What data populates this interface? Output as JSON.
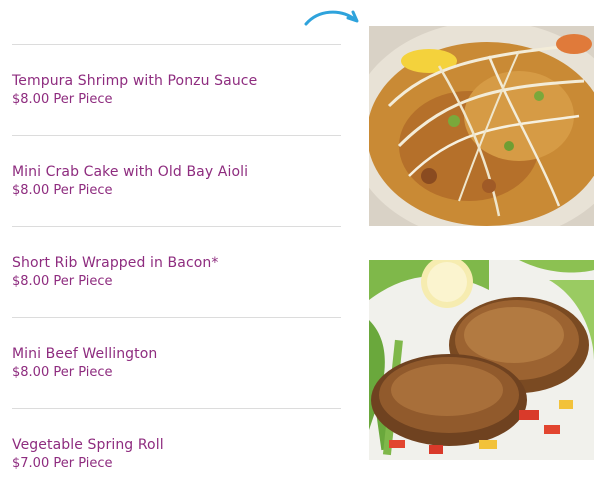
{
  "menu": {
    "items": [
      {
        "name": "Tempura Shrimp with Ponzu Sauce",
        "price": "$8.00 Per Piece"
      },
      {
        "name": "Mini Crab Cake with Old Bay Aioli",
        "price": "$8.00 Per Piece"
      },
      {
        "name": "Short Rib Wrapped in Bacon*",
        "price": "$8.00 Per Piece"
      },
      {
        "name": "Mini Beef Wellington",
        "price": "$8.00 Per Piece"
      },
      {
        "name": "Vegetable Spring Roll",
        "price": "$7.00 Per Piece"
      }
    ]
  },
  "decorations": {
    "arrow_icon": "curved-arrow-right-icon",
    "photos": [
      "pad-thai-noodles-photo",
      "crab-cakes-salad-photo"
    ]
  },
  "colors": {
    "item_text": "#8e2c7f",
    "divider": "#dcdcdc",
    "arrow": "#2ea3dc"
  }
}
